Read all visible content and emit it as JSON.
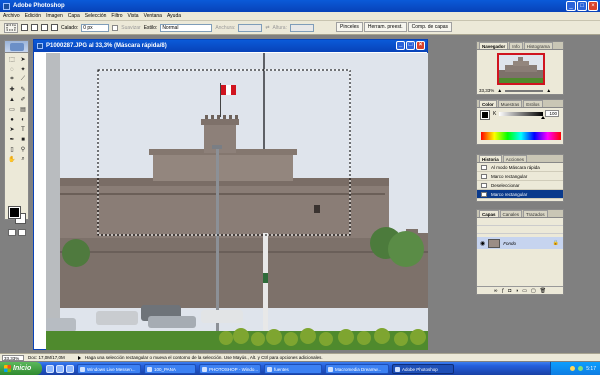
{
  "app": {
    "title": "Adobe Photoshop"
  },
  "menu": [
    "Archivo",
    "Edición",
    "Imagen",
    "Capa",
    "Selección",
    "Filtro",
    "Vista",
    "Ventana",
    "Ayuda"
  ],
  "options": {
    "feather_label": "Calado:",
    "feather_value": "0 px",
    "antialias_label": "Suavizar",
    "style_label": "Estilo:",
    "style_value": "Normal",
    "width_label": "Anchura:",
    "height_label": "Altura:",
    "palette_well": [
      "Pinceles",
      "Herram. preest.",
      "Comp. de capas"
    ]
  },
  "document": {
    "title": "P1000287.JPG al 33,3% (Máscara rápida/8)",
    "content_image": "Fort with flag on tower behind a lamp post, cars and garden in front"
  },
  "navigator": {
    "tabs": [
      "Navegador",
      "Info",
      "Histograma"
    ],
    "zoom": "33,33%"
  },
  "color_panel": {
    "tabs": [
      "Color",
      "Muestras",
      "Estilos"
    ],
    "slider_label": "K",
    "slider_value": "100",
    "slider_level_pct": 100
  },
  "history": {
    "tabs": [
      "Historia",
      "Acciones"
    ],
    "items": [
      "Al modo Máscara rápida",
      "Marco rectangular",
      "Deseleccionar",
      "Marco rectangular"
    ],
    "selected_index": 3
  },
  "layers": {
    "tabs": [
      "Capas",
      "Canales",
      "Trazados"
    ],
    "items": [
      {
        "name": "Fondo"
      }
    ]
  },
  "status": {
    "zoom": "33,33%",
    "doc_size": "Doc: 17,0M/17,0M",
    "hint": "Haga una selección rectangular o mueva el contorno de la selección. Use Mayús., Alt. y Ctrl para opciones adicionales."
  },
  "taskbar": {
    "start": "Inicio",
    "tasks": [
      {
        "label": "Windows Live Messen...",
        "active": false
      },
      {
        "label": "100_PANA",
        "active": false
      },
      {
        "label": "PHOTOSHOP - Windo...",
        "active": false
      },
      {
        "label": "fuentes",
        "active": false
      },
      {
        "label": "Macromedia Dreamw...",
        "active": false
      },
      {
        "label": "Adobe Photoshop",
        "active": true
      }
    ],
    "clock": "5:17"
  },
  "colors": {
    "xp_blue": "#0842b8",
    "flag_red": "#d0141f",
    "history_selected": "#0a3a8c"
  }
}
